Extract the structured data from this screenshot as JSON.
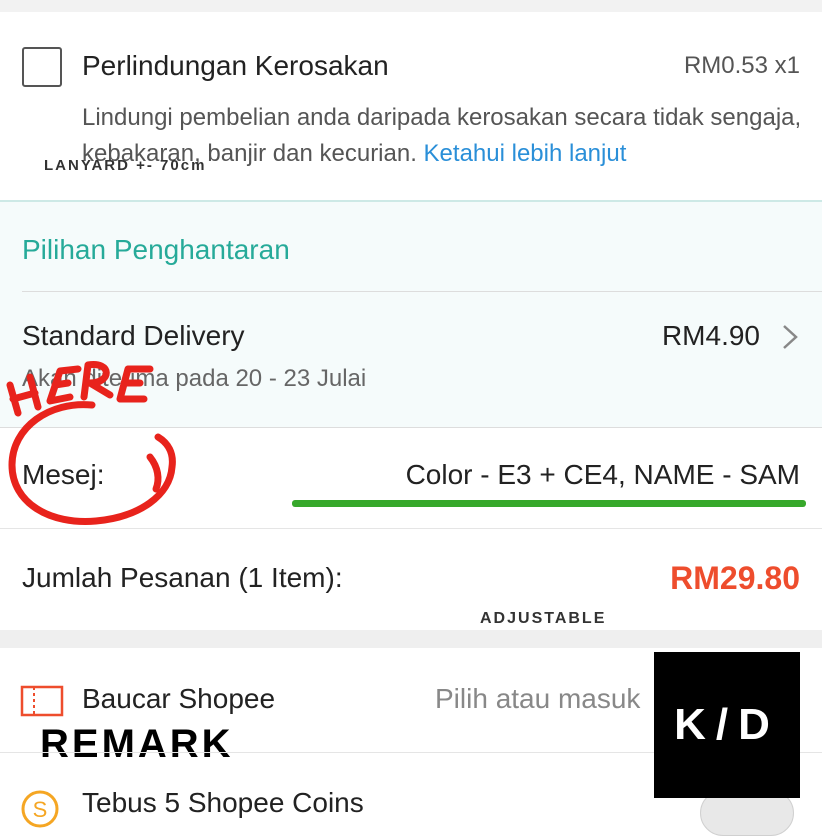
{
  "protection": {
    "title": "Perlindungan Kerosakan",
    "price": "RM0.53  x1",
    "description": "Lindungi pembelian anda daripada kerosakan secara tidak sengaja, kebakaran, banjir dan kecurian.",
    "link": "Ketahui lebih lanjut",
    "checked": false
  },
  "overlay": {
    "lanyard": "LANYARD +- 70cm",
    "adjustable": "ADJUSTABLE",
    "remark": "REMARK",
    "here": "HERE"
  },
  "shipping": {
    "section_title": "Pilihan Penghantaran",
    "option": "Standard Delivery",
    "price": "RM4.90",
    "receive": "Akan diterima pada 20 - 23 Julai"
  },
  "message": {
    "label": "Mesej:",
    "value": "Color  - E3 + CE4,  NAME -  SAM"
  },
  "order_total": {
    "label": "Jumlah Pesanan (1 Item):",
    "value": "RM29.80"
  },
  "voucher": {
    "label": "Baucar Shopee",
    "placeholder": "Pilih atau masuk"
  },
  "coins": {
    "label": "Tebus 5 Shopee Coins",
    "toggle_on": false
  },
  "logo": {
    "text": "K/D"
  },
  "colors": {
    "shopee_orange": "#ee4d2d",
    "teal": "#26aa99",
    "link_blue": "#2a8fd8",
    "annotation_red": "#e8231c",
    "underline_green": "#37a82b"
  }
}
